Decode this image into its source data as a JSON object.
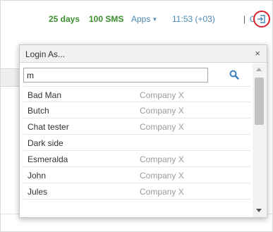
{
  "header": {
    "days": "25 days",
    "sms": "100 SMS",
    "apps_label": "Apps",
    "time": "11:53 (+03)",
    "separator": "|",
    "user": "Caesar",
    "login_icon": "login-as-icon"
  },
  "dialog": {
    "title": "Login As...",
    "close_glyph": "×",
    "search": {
      "value": "m",
      "placeholder": "",
      "icon": "search-icon"
    },
    "users": [
      {
        "name": "Bad Man",
        "company": "Company X"
      },
      {
        "name": "Butch",
        "company": "Company X"
      },
      {
        "name": "Chat tester",
        "company": "Company X"
      },
      {
        "name": "Dark side",
        "company": ""
      },
      {
        "name": "Esmeralda",
        "company": "Company X"
      },
      {
        "name": "John",
        "company": "Company X"
      },
      {
        "name": "Jules",
        "company": "Company X"
      }
    ]
  },
  "colors": {
    "green": "#3a8f2c",
    "link": "#4a8ab5",
    "highlight": "#d8222b"
  }
}
